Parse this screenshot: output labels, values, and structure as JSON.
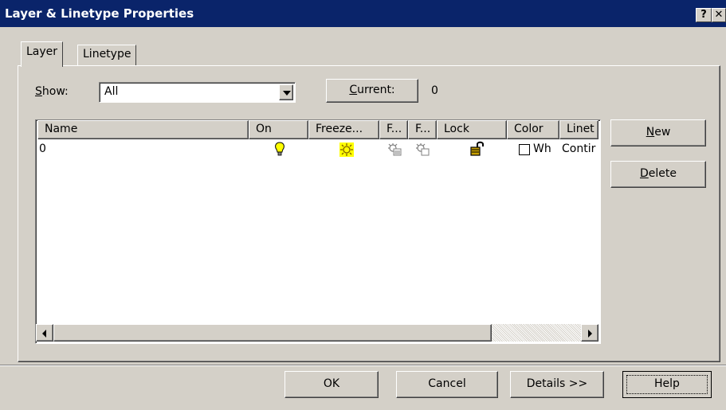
{
  "window": {
    "title": "Layer & Linetype Properties",
    "help_glyph": "?",
    "close_glyph": "✕"
  },
  "tabs": [
    {
      "label": "Layer"
    },
    {
      "label": "Linetype"
    }
  ],
  "show": {
    "label_first": "S",
    "label_rest": "how:",
    "value": "All"
  },
  "current": {
    "label_first": "C",
    "label_rest": "urrent:",
    "value": "0"
  },
  "layer_table": {
    "columns": [
      "Name",
      "On",
      "Freeze...",
      "F...",
      "F...",
      "Lock",
      "Color",
      "Linet"
    ],
    "rows": [
      {
        "name": "0",
        "on_icon": "lightbulb-on-icon",
        "freeze_icon": "sun-thawed-icon",
        "vp_freeze_icon": "viewport-freeze-icon",
        "new_vp_freeze_icon": "new-viewport-freeze-icon",
        "lock_icon": "unlocked-padlock-icon",
        "color": "Wh",
        "linetype": "Contir"
      }
    ]
  },
  "side_buttons": {
    "new": {
      "first": "N",
      "rest": "ew"
    },
    "delete": {
      "first": "D",
      "rest": "elete"
    }
  },
  "footer_buttons": {
    "ok": "OK",
    "cancel": "Cancel",
    "details": "Details >>",
    "help": "Help"
  },
  "colors": {
    "titlebar": "#0a246a",
    "face": "#d4d0c8",
    "bulb": "#ffff00"
  }
}
